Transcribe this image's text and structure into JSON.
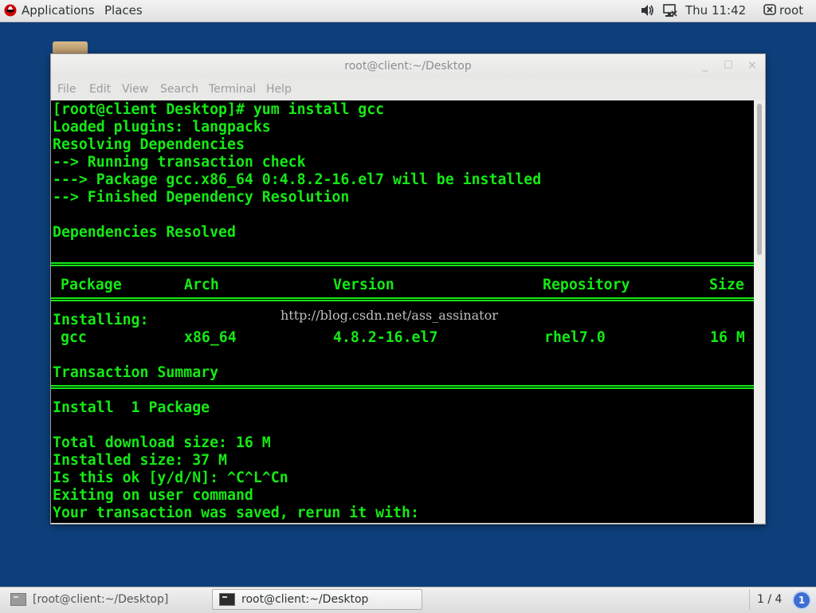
{
  "topbar": {
    "applications": "Applications",
    "places": "Places",
    "clock": "Thu 11:42",
    "user": "root"
  },
  "window": {
    "title": "root@client:~/Desktop",
    "menu": [
      "File",
      "Edit",
      "View",
      "Search",
      "Terminal",
      "Help"
    ]
  },
  "terminal": {
    "lines": [
      "[root@client Desktop]# yum install gcc",
      "Loaded plugins: langpacks",
      "Resolving Dependencies",
      "--> Running transaction check",
      "---> Package gcc.x86_64 0:4.8.2-16.el7 will be installed",
      "--> Finished Dependency Resolution",
      "Dependencies Resolved"
    ],
    "table_header": [
      "Package",
      "Arch",
      "Version",
      "Repository",
      "Size"
    ],
    "installing_label": "Installing:",
    "table_row": [
      "gcc",
      "x86_64",
      "4.8.2-16.el7",
      "rhel7.0",
      "16 M"
    ],
    "summary": [
      "Transaction Summary",
      "Install  1 Package",
      "Total download size: 16 M",
      "Installed size: 37 M",
      "Is this ok [y/d/N]: ^C^L^Cn",
      "Exiting on user command",
      "Your transaction was saved, rerun it with:"
    ],
    "watermark": "http://blog.csdn.net/ass_assinator"
  },
  "taskbar": {
    "tasks": [
      "[root@client:~/Desktop]",
      "root@client:~/Desktop"
    ],
    "workspace": "1 / 4",
    "notifications": "1"
  },
  "colors": {
    "terminal_fg": "#15e915",
    "terminal_bg": "#000000",
    "desktop_bg": "#0e3f7a"
  }
}
